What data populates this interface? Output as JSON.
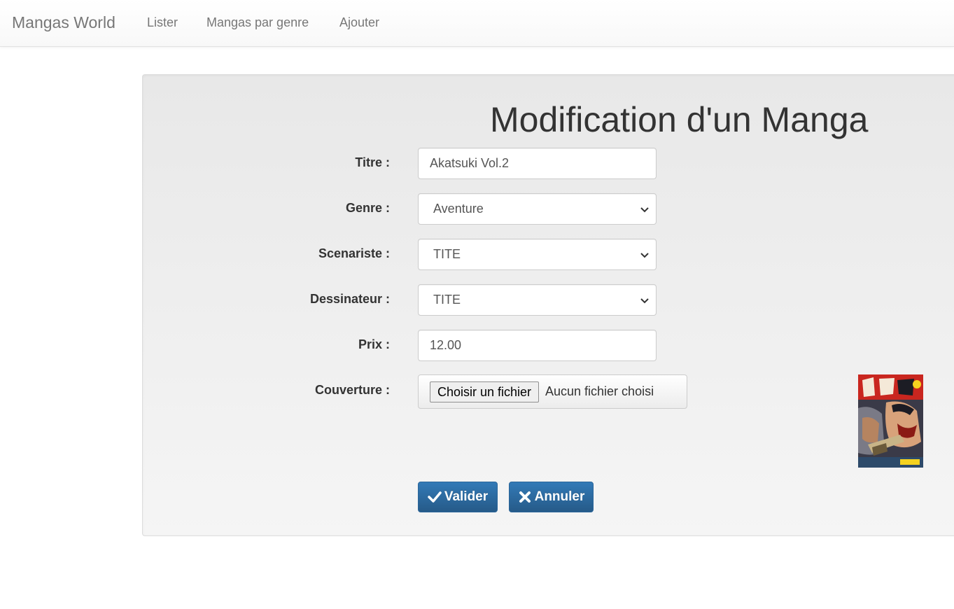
{
  "navbar": {
    "brand": "Mangas World",
    "links": [
      "Lister",
      "Mangas par genre",
      "Ajouter"
    ]
  },
  "form": {
    "title": "Modification d'un Manga",
    "titre": {
      "label": "Titre :",
      "value": "Akatsuki Vol.2"
    },
    "genre": {
      "label": "Genre :",
      "selected": "Aventure"
    },
    "scenariste": {
      "label": "Scenariste :",
      "selected": "TITE"
    },
    "dessinateur": {
      "label": "Dessinateur :",
      "selected": "TITE"
    },
    "prix": {
      "label": "Prix :",
      "value": "12.00"
    },
    "couverture": {
      "label": "Couverture :",
      "button": "Choisir un fichier",
      "status": "Aucun fichier choisi"
    }
  },
  "buttons": {
    "valider": "Valider",
    "annuler": "Annuler"
  },
  "colors": {
    "primary": "#337ab7",
    "navbar_text": "#777777",
    "well_bg": "#eeeeee"
  },
  "icons": {
    "valider": "check-icon",
    "annuler": "close-icon",
    "select": "chevron-down-icon"
  }
}
